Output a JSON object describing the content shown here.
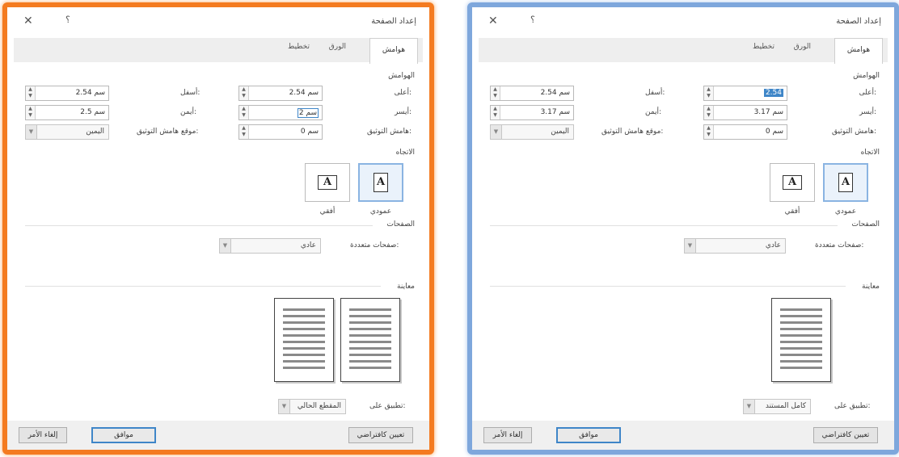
{
  "dialogs": [
    {
      "title": "إعداد الصفحة",
      "help": "؟",
      "close": "✕",
      "tabs": [
        "هوامش",
        "الورق",
        "تخطيط"
      ],
      "margins_heading": "الهوامش",
      "fields": {
        "top_label": "أعلى:",
        "top_value": "2.54 سم",
        "bottom_label": "أسفل:",
        "bottom_value": "2.54 سم",
        "inside_label": "أيسر:",
        "inside_value": "2 سم",
        "outside_label": "أيمن:",
        "outside_value": "2.5 سم",
        "gutter_label": "هامش التوثيق:",
        "gutter_value": "0 سم",
        "gutter_pos_label": "موقع هامش التوثيق:",
        "gutter_pos_value": "اليمين"
      },
      "orientation_heading": "الاتجاه",
      "portrait_label": "عمودي",
      "landscape_label": "أفقي",
      "pages_heading": "الصفحات",
      "multiple_pages_label": "صفحات متعددة:",
      "multiple_pages_value": "عادي",
      "preview_heading": "معاينة",
      "apply_to_label": "تطبيق على:",
      "apply_to_value": "المقطع الحالي",
      "buttons": {
        "set_default": "تعيين كافتراضي",
        "ok": "موافق",
        "cancel": "إلغاء الأمر"
      }
    },
    {
      "title": "إعداد الصفحة",
      "help": "؟",
      "close": "✕",
      "tabs": [
        "هوامش",
        "الورق",
        "تخطيط"
      ],
      "margins_heading": "الهوامش",
      "fields": {
        "top_label": "أعلى:",
        "top_value": "2.54",
        "bottom_label": "أسفل:",
        "bottom_value": "2.54 سم",
        "inside_label": "أيسر:",
        "inside_value": "3.17 سم",
        "outside_label": "أيمن:",
        "outside_value": "3.17 سم",
        "gutter_label": "هامش التوثيق:",
        "gutter_value": "0 سم",
        "gutter_pos_label": "موقع هامش التوثيق:",
        "gutter_pos_value": "اليمين"
      },
      "orientation_heading": "الاتجاه",
      "portrait_label": "عمودي",
      "landscape_label": "أفقي",
      "pages_heading": "الصفحات",
      "multiple_pages_label": "صفحات متعددة:",
      "multiple_pages_value": "عادي",
      "preview_heading": "معاينة",
      "apply_to_label": "تطبيق على:",
      "apply_to_value": "كامل المستند",
      "buttons": {
        "set_default": "تعيين كافتراضي",
        "ok": "موافق",
        "cancel": "إلغاء الأمر"
      }
    }
  ],
  "colors": {
    "left_frame": "#f47b20",
    "right_frame": "#7ea7dc",
    "selection": "#3f86c8"
  },
  "icons": {
    "close": "close-icon",
    "help": "help-icon",
    "spin": "spin-arrows-icon",
    "dropdown": "chevron-down-icon",
    "portrait": "portrait-page-icon",
    "landscape": "landscape-page-icon"
  }
}
